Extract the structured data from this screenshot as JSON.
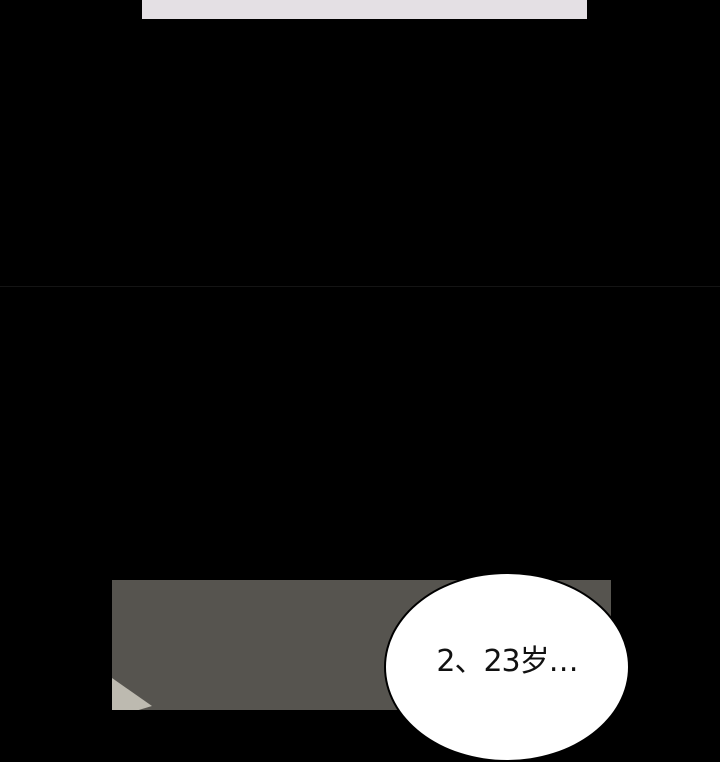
{
  "speech_bubble": {
    "text": "2、23岁…"
  },
  "colors": {
    "background": "#000000",
    "top_panel": "#e4e0e4",
    "scene_panel": "#56544f",
    "bubble": "#ffffff"
  }
}
